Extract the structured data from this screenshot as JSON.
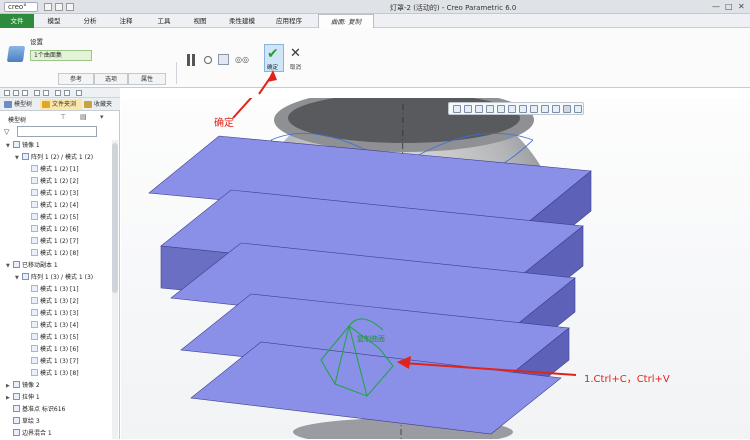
{
  "app": {
    "logo": "creo°",
    "window_title": "灯罩-2 (活动的) - Creo Parametric 6.0",
    "window_controls": [
      "—",
      "□",
      "✕"
    ]
  },
  "menu": {
    "items": [
      "文件",
      "模型",
      "分析",
      "注释",
      "工具",
      "视图",
      "柔性建模",
      "应用程序"
    ],
    "active_tab": "曲面: 复制"
  },
  "ribbon": {
    "settings_label": "设置",
    "surface_field": "1个曲面集",
    "tabs": [
      "参考",
      "选项",
      "属性"
    ],
    "ok_label": "确定",
    "cancel_label": "取消"
  },
  "panel": {
    "tabs": [
      "模型树",
      "文件夹浏",
      "收藏夹"
    ],
    "tree_header": "模型树"
  },
  "tree": [
    {
      "level": 0,
      "toggle": "▼",
      "label": "镜像 1"
    },
    {
      "level": 1,
      "toggle": "▼",
      "label": "阵列 1 (2) / 模式 1 (2)"
    },
    {
      "level": 2,
      "toggle": "",
      "label": "模式 1 (2) [1]"
    },
    {
      "level": 2,
      "toggle": "",
      "label": "模式 1 (2) [2]"
    },
    {
      "level": 2,
      "toggle": "",
      "label": "模式 1 (2) [3]"
    },
    {
      "level": 2,
      "toggle": "",
      "label": "模式 1 (2) [4]"
    },
    {
      "level": 2,
      "toggle": "",
      "label": "模式 1 (2) [5]"
    },
    {
      "level": 2,
      "toggle": "",
      "label": "模式 1 (2) [6]"
    },
    {
      "level": 2,
      "toggle": "",
      "label": "模式 1 (2) [7]"
    },
    {
      "level": 2,
      "toggle": "",
      "label": "模式 1 (2) [8]"
    },
    {
      "level": 0,
      "toggle": "▼",
      "label": "已移动副本 1"
    },
    {
      "level": 1,
      "toggle": "▼",
      "label": "阵列 1 (3) / 模式 1 (3)"
    },
    {
      "level": 2,
      "toggle": "",
      "label": "模式 1 (3) [1]"
    },
    {
      "level": 2,
      "toggle": "",
      "label": "模式 1 (3) [2]"
    },
    {
      "level": 2,
      "toggle": "",
      "label": "模式 1 (3) [3]"
    },
    {
      "level": 2,
      "toggle": "",
      "label": "模式 1 (3) [4]"
    },
    {
      "level": 2,
      "toggle": "",
      "label": "模式 1 (3) [5]"
    },
    {
      "level": 2,
      "toggle": "",
      "label": "模式 1 (3) [6]"
    },
    {
      "level": 2,
      "toggle": "",
      "label": "模式 1 (3) [7]"
    },
    {
      "level": 2,
      "toggle": "",
      "label": "模式 1 (3) [8]"
    },
    {
      "level": 0,
      "toggle": "▶",
      "label": "镜像 2"
    },
    {
      "level": 0,
      "toggle": "▶",
      "label": "拉伸 1"
    },
    {
      "level": 0,
      "toggle": "",
      "label": "基准点 标识616"
    },
    {
      "level": 0,
      "toggle": "",
      "label": "草绘 3"
    },
    {
      "level": 0,
      "toggle": "",
      "label": "边界混合 1"
    }
  ],
  "viewport": {
    "model_label": "复制曲面"
  },
  "annotations": {
    "confirm": "确定",
    "shortcut": "1.Ctrl+C，Ctrl+V"
  },
  "colors": {
    "accent_green": "#2c8c3b",
    "annotation_red": "#e2231a",
    "plane_fill": "#8a90e8",
    "plane_side": "#5d61b8"
  }
}
